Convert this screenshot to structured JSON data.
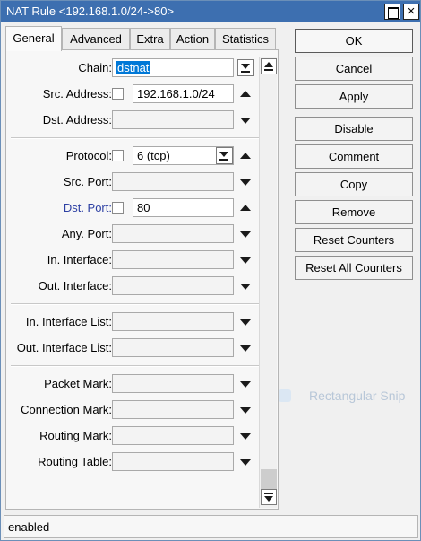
{
  "window": {
    "title": "NAT Rule <192.168.1.0/24->80>",
    "close_glyph": "×"
  },
  "tabs": [
    "General",
    "Advanced",
    "Extra",
    "Action",
    "Statistics"
  ],
  "fields": {
    "chain": {
      "label": "Chain:",
      "value": "dstnat"
    },
    "src_address": {
      "label": "Src. Address:",
      "value": "192.168.1.0/24"
    },
    "dst_address": {
      "label": "Dst. Address:",
      "value": ""
    },
    "protocol": {
      "label": "Protocol:",
      "value": "6 (tcp)"
    },
    "src_port": {
      "label": "Src. Port:",
      "value": ""
    },
    "dst_port": {
      "label": "Dst. Port:",
      "value": "80"
    },
    "any_port": {
      "label": "Any. Port:",
      "value": ""
    },
    "in_interface": {
      "label": "In. Interface:",
      "value": ""
    },
    "out_interface": {
      "label": "Out. Interface:",
      "value": ""
    },
    "in_interface_list": {
      "label": "In. Interface List:",
      "value": ""
    },
    "out_interface_list": {
      "label": "Out. Interface List:",
      "value": ""
    },
    "packet_mark": {
      "label": "Packet Mark:",
      "value": ""
    },
    "connection_mark": {
      "label": "Connection Mark:",
      "value": ""
    },
    "routing_mark": {
      "label": "Routing Mark:",
      "value": ""
    },
    "routing_table": {
      "label": "Routing Table:",
      "value": ""
    }
  },
  "buttons": {
    "ok": "OK",
    "cancel": "Cancel",
    "apply": "Apply",
    "disable": "Disable",
    "comment": "Comment",
    "copy": "Copy",
    "remove": "Remove",
    "reset_counters": "Reset Counters",
    "reset_all_counters": "Reset All Counters"
  },
  "status_text": "enabled",
  "overlay_text": "Rectangular Snip",
  "colors": {
    "titlebar": "#3d6fb0",
    "selection": "#0078d7",
    "dst_port_label": "#2c3fa3"
  }
}
